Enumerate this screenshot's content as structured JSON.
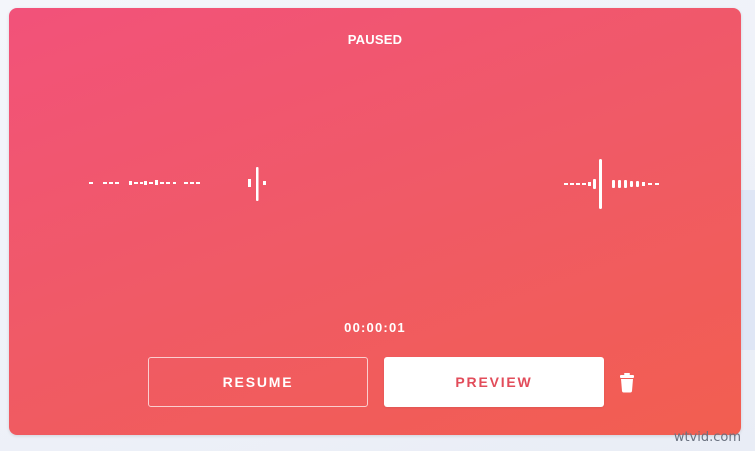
{
  "recorder": {
    "status": "PAUSED",
    "elapsed": "00:00:01",
    "buttons": {
      "resume_label": "RESUME",
      "preview_label": "PREVIEW"
    },
    "delete_icon": "trash-icon",
    "colors": {
      "gradient_start": "#f2527a",
      "gradient_end": "#f25e50",
      "preview_text": "#e24c5a"
    }
  },
  "watermark": "wtvid.com"
}
